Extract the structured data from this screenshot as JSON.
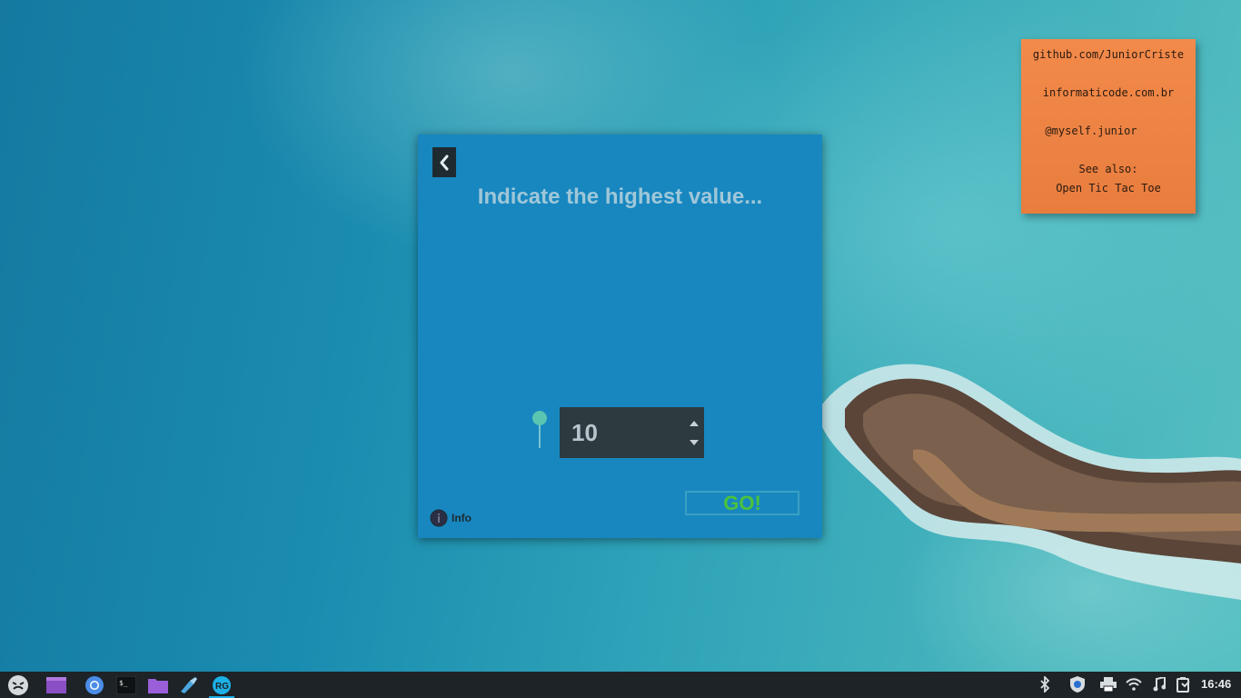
{
  "desktop": {
    "note": {
      "lines": [
        "github.com/JuniorCriste",
        "informaticode.com.br",
        "@myself.junior",
        "See also:",
        "Open Tic Tac Toe"
      ]
    }
  },
  "app": {
    "title": "Indicate the highest value...",
    "back_icon": "chevron-left-icon",
    "spinbox": {
      "value": "10"
    },
    "slider": {
      "level": 0
    },
    "go_label": "GO!",
    "info_label": "Info",
    "colors": {
      "panel": "#1887c0",
      "go_text": "#4cc23c",
      "title_text": "#9fc7d8"
    }
  },
  "taskbar": {
    "launchers": [
      "app-menu-icon",
      "window-icon",
      "chromium-icon",
      "terminal-icon",
      "files-icon",
      "ide-icon",
      "app-icon"
    ],
    "tray": [
      "bluetooth-icon",
      "shield-icon",
      "printer-icon",
      "wifi-icon",
      "music-icon",
      "battery-icon"
    ],
    "clock": "16:46"
  }
}
